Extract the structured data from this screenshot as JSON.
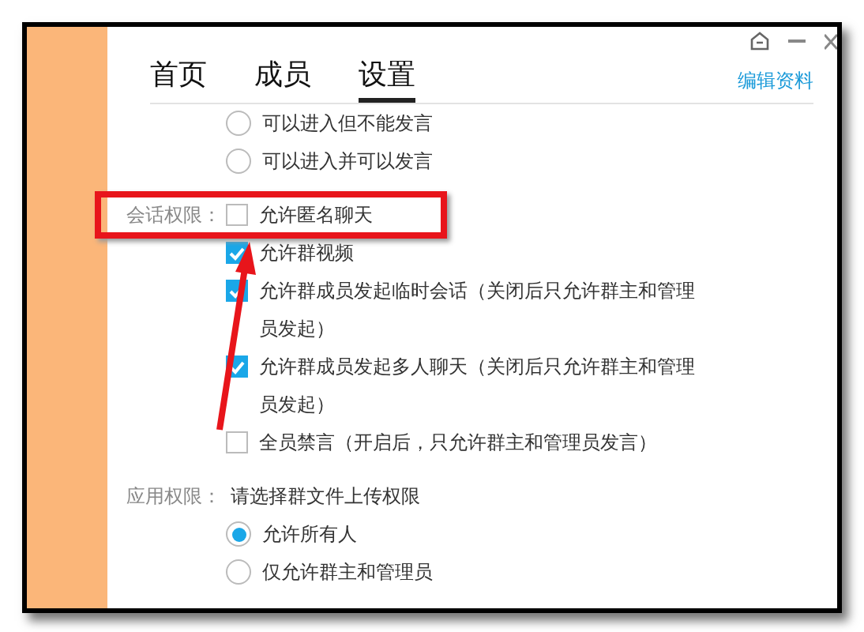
{
  "tabs": [
    {
      "label": "首页",
      "selected": false
    },
    {
      "label": "成员",
      "selected": false
    },
    {
      "label": "设置",
      "selected": true
    }
  ],
  "edit_link": "编辑资料",
  "sections": [
    {
      "items": [
        {
          "kind": "radio",
          "label": "可以进入但不能发言",
          "selected": false
        },
        {
          "kind": "radio",
          "label": "可以进入并可以发言",
          "selected": false
        }
      ]
    },
    {
      "label": "会话权限：",
      "items": [
        {
          "kind": "checkbox",
          "label": "允许匿名聊天",
          "checked": false
        },
        {
          "kind": "checkbox",
          "label": "允许群视频",
          "checked": true
        },
        {
          "kind": "checkbox",
          "label": "允许群成员发起临时会话（关闭后只允许群主和管理员发起）",
          "checked": true
        },
        {
          "kind": "checkbox",
          "label": "允许群成员发起多人聊天（关闭后只允许群主和管理员发起）",
          "checked": true
        },
        {
          "kind": "checkbox",
          "label": "全员禁言（开启后，只允许群主和管理员发言）",
          "checked": false
        }
      ]
    },
    {
      "label": "应用权限：",
      "items": [
        {
          "kind": "text",
          "label": "请选择群文件上传权限"
        },
        {
          "kind": "radio",
          "label": "允许所有人",
          "selected": true
        },
        {
          "kind": "radio",
          "label": "仅允许群主和管理员",
          "selected": false
        }
      ]
    }
  ]
}
